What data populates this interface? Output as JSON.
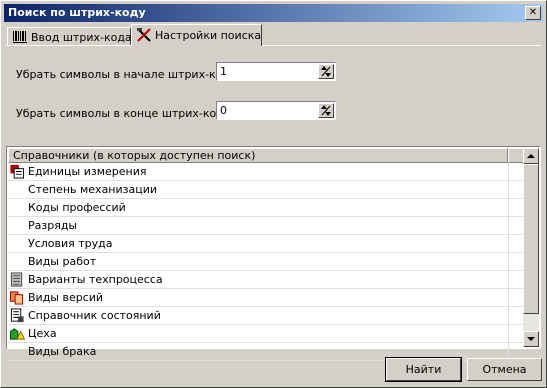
{
  "window": {
    "title": "Поиск по штрих-коду",
    "close_glyph": "✕"
  },
  "tabs": [
    {
      "label": "Ввод штрих-кода",
      "icon": "barcode-icon",
      "active": false
    },
    {
      "label": "Настройки поиска",
      "icon": "tools-icon",
      "active": true
    }
  ],
  "settings": {
    "trim_start_label": "Убрать символы в начале штрих-кода:",
    "trim_start_value": "1",
    "trim_end_label": "Убрать символы в конце штрих-кода:",
    "trim_end_value": "0"
  },
  "list": {
    "header": "Справочники (в которых доступен поиск)",
    "items": [
      {
        "label": "Единицы измерения",
        "icon": "units-icon"
      },
      {
        "label": "Степень механизации",
        "icon": ""
      },
      {
        "label": "Коды профессий",
        "icon": ""
      },
      {
        "label": "Разряды",
        "icon": ""
      },
      {
        "label": "Условия труда",
        "icon": ""
      },
      {
        "label": "Виды работ",
        "icon": ""
      },
      {
        "label": "Варианты техпроцесса",
        "icon": "process-icon"
      },
      {
        "label": "Виды версий",
        "icon": "versions-icon"
      },
      {
        "label": "Справочник состояний",
        "icon": "states-icon"
      },
      {
        "label": "Цеха",
        "icon": "workshop-icon"
      },
      {
        "label": "Виды брака",
        "icon": ""
      }
    ]
  },
  "buttons": {
    "ok": "Найти",
    "cancel": "Отмена"
  }
}
